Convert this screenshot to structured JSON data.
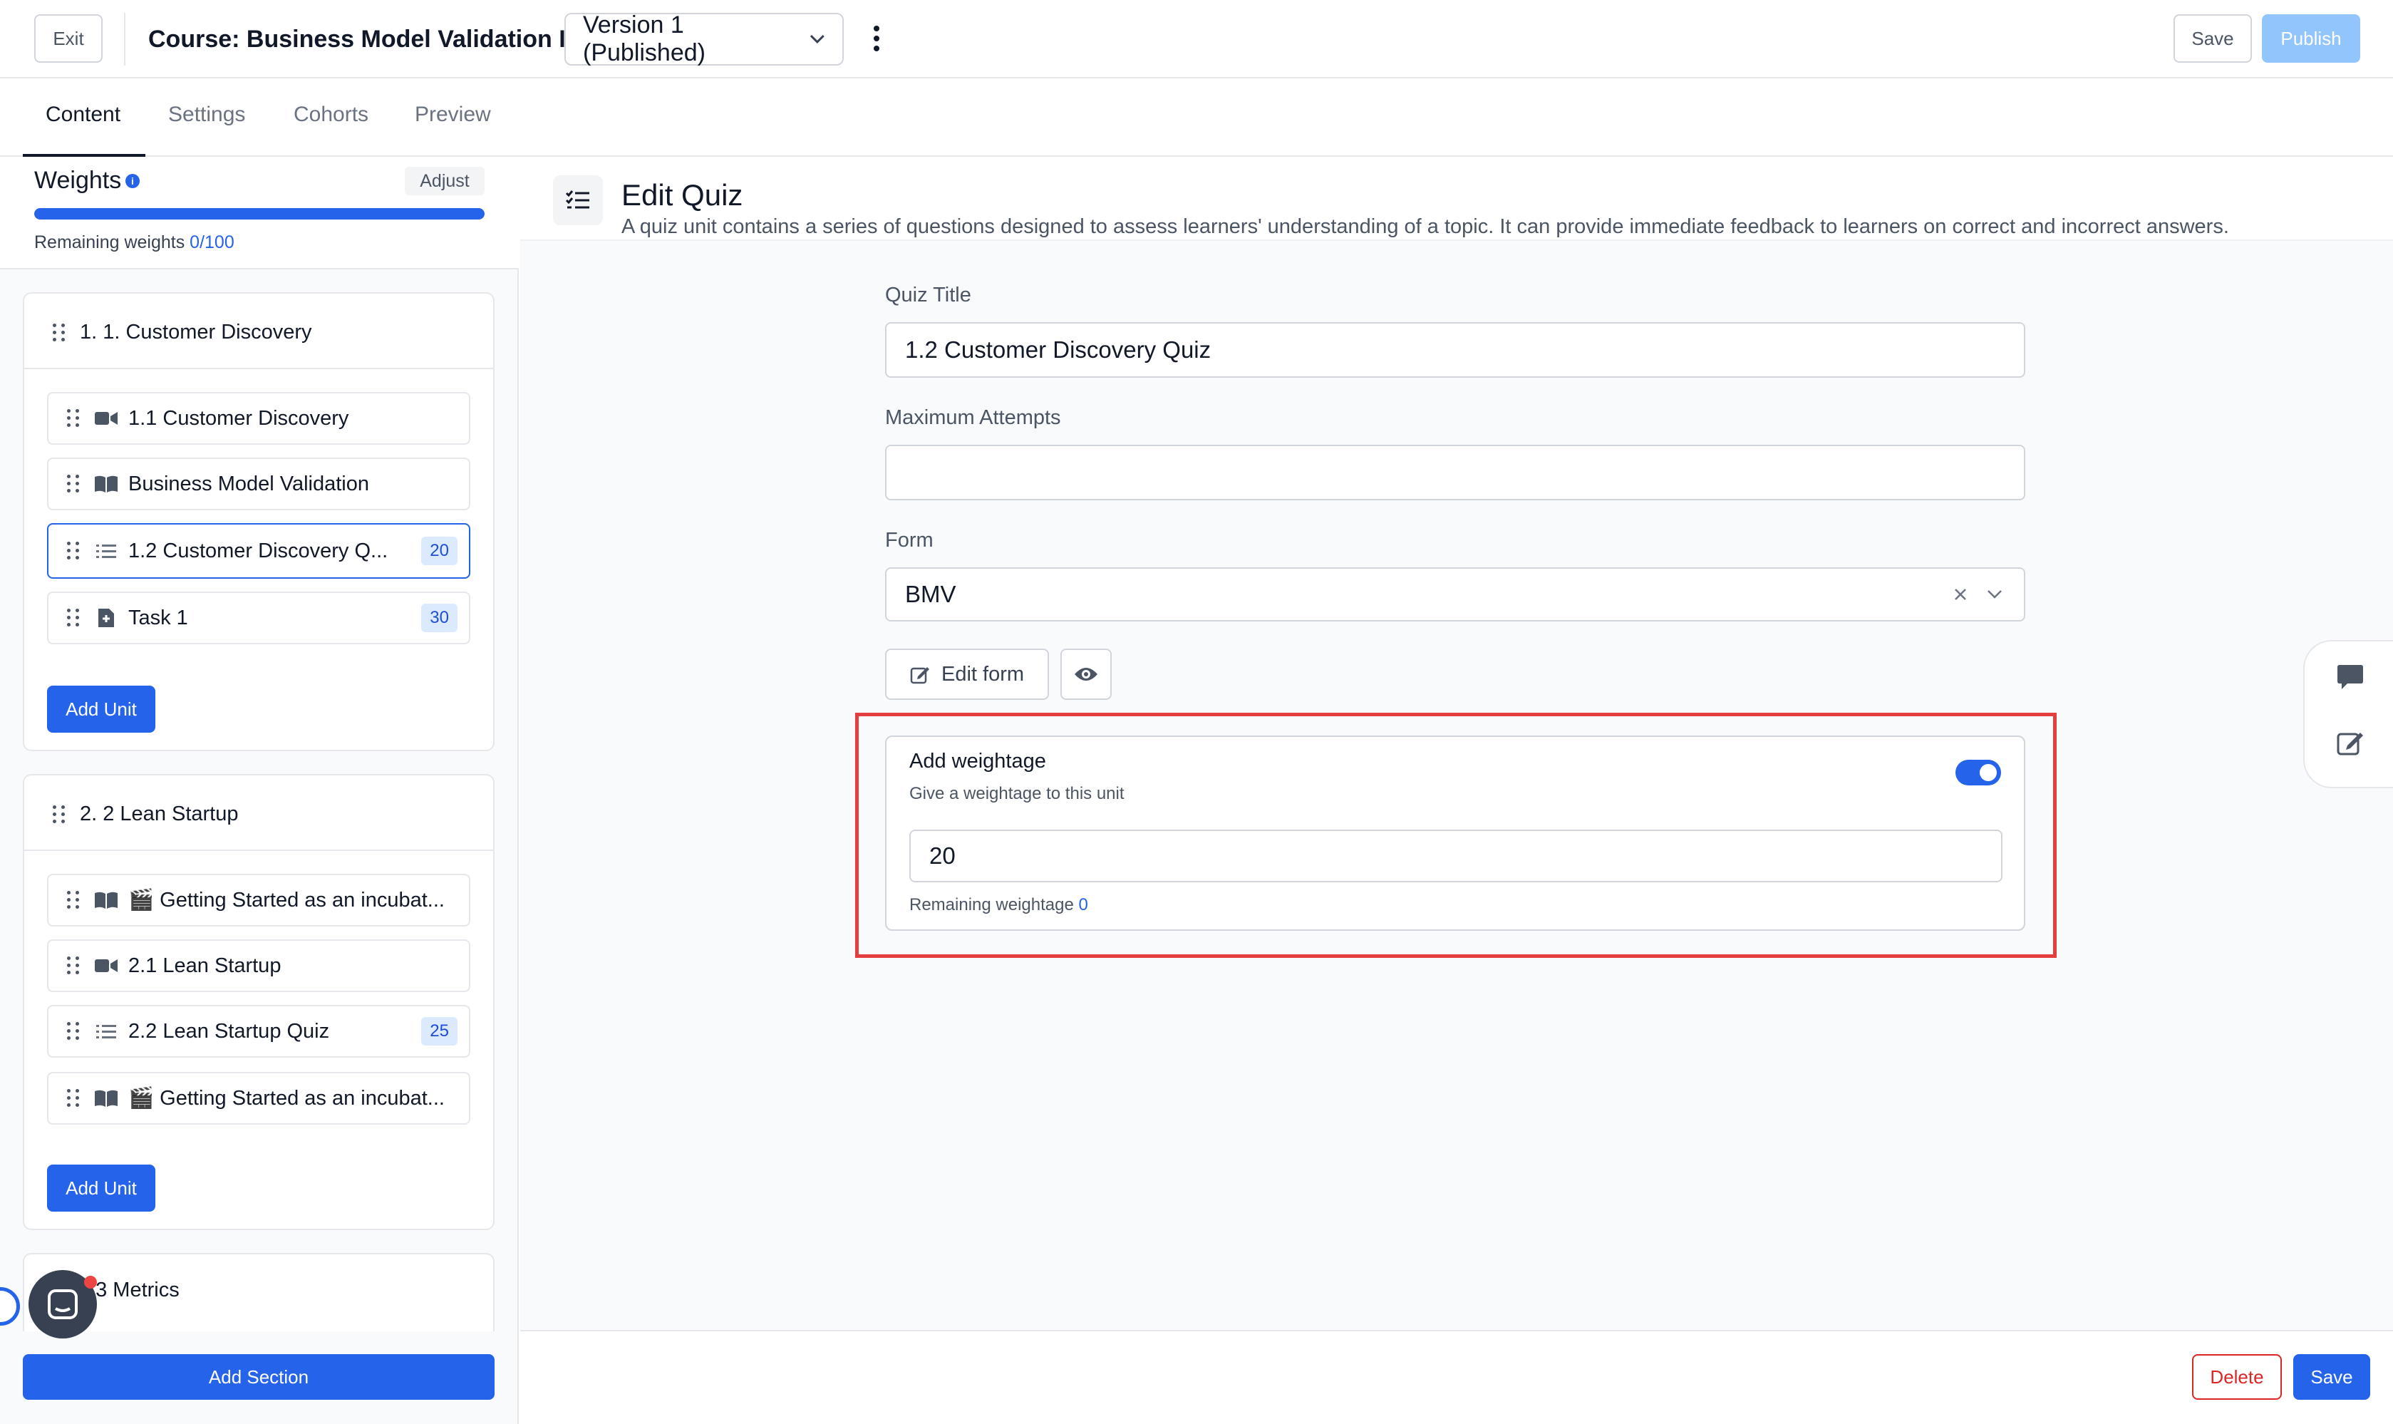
{
  "topbar": {
    "exit_label": "Exit",
    "course_title": "Course: Business Model Validation I",
    "version_label": "Version 1 (Published)",
    "save_label": "Save",
    "publish_label": "Publish"
  },
  "tabs": [
    "Content",
    "Settings",
    "Cohorts",
    "Preview"
  ],
  "weights": {
    "title": "Weights",
    "adjust_label": "Adjust",
    "remaining_prefix": "Remaining weights",
    "remaining_value": "0/100",
    "progress_fraction": 1.0
  },
  "sections": [
    {
      "title": "1. 1. Customer Discovery",
      "units": [
        {
          "label": "1.1 Customer Discovery",
          "icon": "video-icon",
          "badge": ""
        },
        {
          "label": "Business Model Validation",
          "icon": "book-icon",
          "badge": ""
        },
        {
          "label": "1.2 Customer Discovery Q...",
          "icon": "list-icon",
          "badge": "20",
          "selected": true
        },
        {
          "label": "Task 1",
          "icon": "task-icon",
          "badge": "30"
        }
      ],
      "add_unit_label": "Add Unit"
    },
    {
      "title": "2. 2 Lean Startup",
      "units": [
        {
          "label": "🎬 Getting Started as an incubat...",
          "icon": "book-icon",
          "badge": ""
        },
        {
          "label": "2.1 Lean Startup",
          "icon": "video-icon",
          "badge": ""
        },
        {
          "label": "2.2 Lean Startup Quiz",
          "icon": "list-icon",
          "badge": "25"
        },
        {
          "label": "🎬 Getting Started as an incubat...",
          "icon": "book-icon",
          "badge": ""
        }
      ],
      "add_unit_label": "Add Unit"
    },
    {
      "title": ". 3 Metrics",
      "units": []
    }
  ],
  "add_section_label": "Add Section",
  "edit_quiz": {
    "title": "Edit Quiz",
    "description": "A quiz unit contains a series of questions designed to assess learners' understanding of a topic. It can provide immediate feedback to learners on correct and incorrect answers.",
    "quiz_title_label": "Quiz Title",
    "quiz_title_value": "1.2 Customer Discovery Quiz",
    "max_attempts_label": "Maximum Attempts",
    "max_attempts_value": "",
    "form_label": "Form",
    "form_value": "BMV",
    "edit_form_label": "Edit form"
  },
  "weightage": {
    "title": "Add weightage",
    "subtitle": "Give a weightage to this unit",
    "enabled": true,
    "value": "20",
    "remaining_prefix": "Remaining weightage",
    "remaining_value": "0"
  },
  "footer": {
    "delete_label": "Delete",
    "save_label": "Save"
  },
  "colors": {
    "primary": "#2563eb",
    "highlight": "#e53e3e",
    "publish_disabled": "#93c5fd"
  }
}
